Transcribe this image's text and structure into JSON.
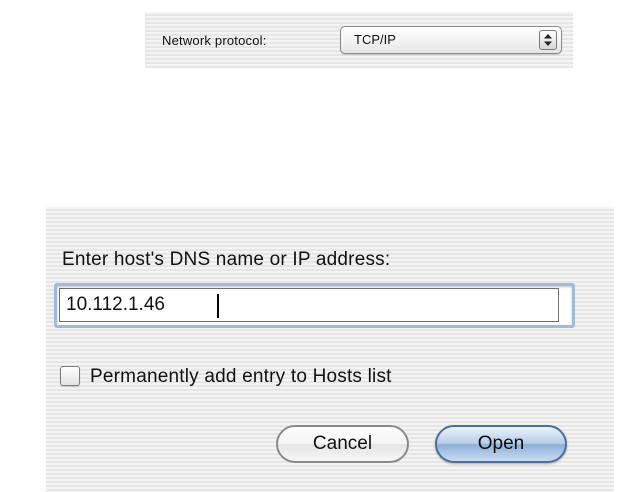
{
  "network": {
    "protocol_label": "Network protocol:",
    "protocol_value": "TCP/IP"
  },
  "dialog": {
    "prompt": "Enter host's DNS name or IP address:",
    "host_value": "10.112.1.46",
    "permanent_label": "Permanently add entry to Hosts list",
    "permanent_checked": false,
    "cancel_label": "Cancel",
    "open_label": "Open"
  },
  "icons": {
    "protocol_arrows": "up-down-arrows-icon"
  },
  "colors": {
    "focus_ring": "#9fbbdc",
    "default_button": "#8fb0d8"
  }
}
